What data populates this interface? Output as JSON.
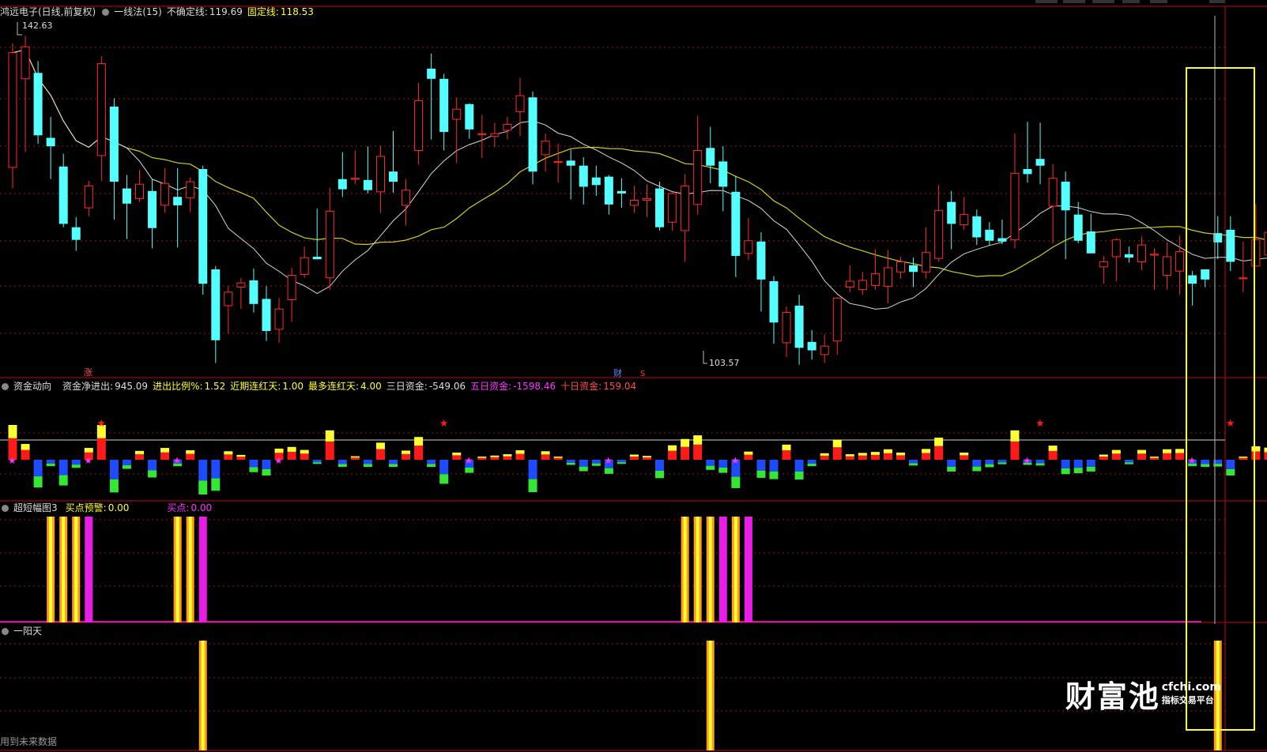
{
  "header": {
    "stock_name": "鸿远电子(日线,前复权)",
    "indicator_name": "一线法(15)",
    "uncertain_label": "不确定线:",
    "uncertain_value": "119.69",
    "fixed_label": "固定线:",
    "fixed_value": "118.53"
  },
  "price_panel": {
    "high_label": "142.63",
    "low_label": "103.57",
    "marker_zhang": "涨",
    "marker_cai": "财",
    "marker_s": "S",
    "candles": [
      [
        127,
        140.6,
        141.7,
        124.5
      ],
      [
        137.5,
        141.3,
        142.6,
        128.8
      ],
      [
        138.2,
        130.8,
        139.6,
        129.8
      ],
      [
        130.5,
        129.5,
        133.0,
        125.6
      ],
      [
        127.1,
        120.3,
        128.6,
        119.9
      ],
      [
        119.9,
        118.4,
        121.1,
        117.1
      ],
      [
        122.2,
        124.8,
        125.4,
        121.2
      ],
      [
        128.4,
        139.3,
        140.2,
        125.4
      ],
      [
        134.2,
        125.3,
        135.2,
        120.8
      ],
      [
        124.5,
        122.7,
        126.1,
        118.5
      ],
      [
        123.3,
        125.0,
        126.7,
        122.9
      ],
      [
        124.2,
        119.8,
        125.6,
        117.4
      ],
      [
        122.5,
        125.1,
        126.9,
        121.6
      ],
      [
        123.5,
        122.5,
        126.9,
        117.5
      ],
      [
        123.4,
        125.3,
        125.8,
        121.7
      ],
      [
        126.8,
        113.2,
        127.2,
        111.9
      ],
      [
        114.9,
        106.5,
        115.3,
        103.8
      ],
      [
        110.6,
        112.2,
        112.9,
        107.3
      ],
      [
        112.8,
        113.3,
        113.9,
        110.2
      ],
      [
        113.6,
        110.8,
        115.0,
        109.8
      ],
      [
        111.4,
        107.6,
        112.9,
        106.4
      ],
      [
        107.8,
        110.2,
        111.5,
        106.2
      ],
      [
        111.3,
        114.2,
        115.1,
        108.7
      ],
      [
        114.3,
        116.3,
        117.6,
        113.9
      ],
      [
        116.4,
        116.1,
        122.1,
        116.1
      ],
      [
        113.9,
        121.8,
        124.6,
        112.5
      ],
      [
        125.6,
        124.4,
        128.8,
        123.5
      ],
      [
        125.6,
        125.7,
        129.0,
        125.0
      ],
      [
        125.5,
        124.3,
        129.5,
        123.9
      ],
      [
        124.1,
        128.3,
        129.6,
        121.6
      ],
      [
        126.5,
        125.3,
        131.3,
        124.0
      ],
      [
        122.5,
        124.3,
        125.6,
        120.1
      ],
      [
        129.0,
        134.9,
        137.0,
        127.3
      ],
      [
        138.7,
        137.5,
        140.5,
        130.3
      ],
      [
        137.5,
        131.2,
        138.1,
        129.0
      ],
      [
        132.7,
        133.9,
        135.3,
        127.5
      ],
      [
        134.5,
        131.5,
        134.6,
        130.4
      ],
      [
        131.0,
        131.0,
        133.2,
        128.1
      ],
      [
        130.7,
        131.0,
        132.3,
        129.4
      ],
      [
        131.4,
        132.1,
        133.0,
        130.3
      ],
      [
        133.6,
        135.5,
        137.6,
        130.7
      ],
      [
        135.3,
        126.5,
        136.0,
        125.0
      ],
      [
        128.5,
        130.1,
        131.0,
        126.5
      ],
      [
        127.7,
        127.7,
        129.8,
        125.2
      ],
      [
        127.8,
        127.2,
        129.1,
        123.2
      ],
      [
        127.2,
        124.7,
        128.2,
        122.6
      ],
      [
        125.8,
        124.9,
        127.2,
        123.6
      ],
      [
        125.9,
        122.6,
        126.1,
        121.4
      ],
      [
        124.2,
        123.9,
        125.7,
        122.2
      ],
      [
        122.5,
        123.1,
        124.8,
        121.6
      ],
      [
        123.1,
        123.3,
        125.0,
        121.1
      ],
      [
        124.5,
        119.9,
        125.3,
        119.5
      ],
      [
        120.5,
        123.9,
        124.1,
        119.5
      ],
      [
        119.5,
        124.8,
        126.2,
        115.8
      ],
      [
        122.6,
        129.0,
        133.1,
        121.4
      ],
      [
        129.3,
        127.2,
        131.8,
        125.1
      ],
      [
        127.7,
        124.7,
        129.5,
        121.8
      ],
      [
        124.1,
        116.5,
        126.0,
        114.0
      ],
      [
        116.8,
        118.3,
        121.0,
        116.0
      ],
      [
        118.2,
        113.7,
        119.3,
        109.9
      ],
      [
        113.5,
        108.6,
        114.1,
        106.1
      ],
      [
        106.2,
        109.8,
        110.5,
        104.5
      ],
      [
        110.6,
        105.6,
        111.9,
        103.6
      ],
      [
        106.3,
        105.3,
        107.7,
        104.2
      ],
      [
        104.8,
        105.8,
        107.2,
        103.8
      ],
      [
        106.4,
        111.5,
        111.6,
        104.8
      ],
      [
        112.8,
        113.5,
        115.4,
        112.2
      ],
      [
        112.5,
        113.6,
        114.6,
        111.9
      ],
      [
        113.0,
        114.4,
        117.3,
        112.5
      ],
      [
        112.9,
        115.1,
        117.2,
        110.9
      ],
      [
        114.6,
        115.8,
        116.4,
        113.8
      ],
      [
        115.4,
        114.6,
        116.3,
        112.8
      ],
      [
        114.6,
        116.9,
        119.9,
        113.8
      ],
      [
        116.2,
        121.9,
        124.9,
        115.8
      ],
      [
        122.9,
        120.3,
        124.2,
        117.3
      ],
      [
        120.2,
        121.4,
        123.5,
        119.6
      ],
      [
        121.2,
        118.7,
        122.0,
        117.8
      ],
      [
        119.6,
        118.3,
        120.5,
        117.7
      ],
      [
        118.6,
        118.2,
        120.8,
        117.9
      ],
      [
        118.4,
        126.3,
        131.0,
        117.4
      ],
      [
        126.8,
        126.2,
        132.4,
        125.2
      ],
      [
        128.0,
        127.2,
        132.3,
        125.0
      ],
      [
        122.4,
        125.7,
        127.4,
        118.0
      ],
      [
        125.3,
        121.9,
        126.5,
        116.1
      ],
      [
        121.4,
        118.3,
        122.9,
        118.0
      ],
      [
        119.4,
        116.8,
        121.5,
        117.1
      ],
      [
        115.2,
        115.8,
        116.5,
        113.2
      ],
      [
        116.4,
        118.4,
        118.6,
        113.5
      ],
      [
        116.7,
        116.3,
        117.6,
        115.7
      ],
      [
        115.8,
        117.8,
        118.8,
        114.8
      ],
      [
        116.7,
        116.7,
        117.4,
        112.5
      ],
      [
        114.2,
        116.4,
        118.1,
        112.5
      ],
      [
        114.7,
        117.0,
        118.9,
        111.9
      ],
      [
        114.2,
        113.2,
        114.7,
        110.6
      ],
      [
        114.9,
        113.7,
        114.7,
        112.8
      ],
      [
        119.2,
        118.1,
        121.2,
        116.1
      ],
      [
        119.6,
        115.8,
        121.2,
        114.7
      ],
      [
        113.9,
        113.9,
        118.2,
        112.2
      ],
      [
        115.3,
        118.4,
        122.6,
        115.6
      ],
      [
        116.6,
        119.3,
        121.8,
        116.6
      ],
      [
        121.4,
        121.8,
        125.9,
        120.7
      ],
      [
        121.6,
        122.0,
        124.2,
        119.8
      ],
      [
        123.3,
        123.3,
        124.5,
        121.5
      ],
      [
        123.1,
        127.6,
        128.6,
        123.0
      ],
      [
        127.6,
        122.8,
        128.5,
        122.4
      ],
      [
        121.7,
        118.9,
        123.0,
        117.1
      ],
      [
        119.6,
        120.1,
        121.9,
        118.6
      ],
      [
        118.3,
        115.2,
        118.5,
        113.9
      ],
      [
        115.9,
        119.5,
        126.3,
        113.8
      ],
      [
        126.6,
        129.3,
        133.1,
        126.4
      ]
    ]
  },
  "money_panel": {
    "title": "资金动向",
    "net_label": "资金净进出:",
    "net_value": "945.09",
    "ratio_label": "进出比例%:",
    "ratio_value": "1.52",
    "recent_red_label": "近期连红天:",
    "recent_red_value": "1.00",
    "max_red_label": "最多连红天:",
    "max_red_value": "4.00",
    "three_day_label": "三日资金:",
    "three_day_value": "-549.06",
    "five_day_label": "五日资金:",
    "five_day_value": "-1598.46",
    "ten_day_label": "十日资金:",
    "ten_day_value": "159.04"
  },
  "short_panel": {
    "title": "超短幅图3",
    "warning_label": "买点预警:",
    "warning_value": "0.00",
    "buy_label": "买点:",
    "buy_value": "0.00"
  },
  "yang_panel": {
    "title": "一阳天",
    "footer_text": "用到未来数据"
  },
  "watermark": {
    "brand": "财富池",
    "url": "cfchi.com",
    "subtitle": "指标交易平台"
  },
  "colors": {
    "up": "#ff2a2a",
    "down": "#54ffff",
    "ma_white": "#d8d8d8",
    "ma_yellow": "#cfcf1a",
    "panel_border": "#c8001e",
    "grid": "#8c1b1b",
    "highlight_box": "#ffff33",
    "magenta": "#ff33ff",
    "bar_yellow": "#ffff33",
    "bar_red": "#ff1a1a",
    "bar_blue": "#1f4bff",
    "bar_green": "#33e833",
    "orange": "#ff9c1a"
  }
}
